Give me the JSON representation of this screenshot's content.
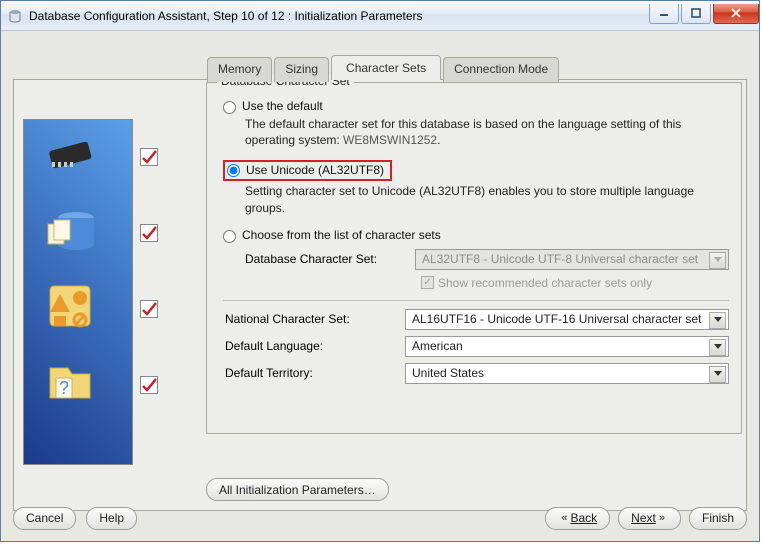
{
  "window": {
    "title": "Database Configuration Assistant, Step 10 of 12 : Initialization Parameters"
  },
  "tabs": {
    "memory": "Memory",
    "sizing": "Sizing",
    "charsets": "Character Sets",
    "connmode": "Connection Mode",
    "active": "charsets"
  },
  "group": {
    "title": "Database Character Set",
    "opt_default": {
      "label": "Use the default",
      "desc_pre": "The default character set for this database is based on the language setting of this operating system: ",
      "os_charset": "WE8MSWIN1252",
      "desc_post": "."
    },
    "opt_unicode": {
      "label": "Use Unicode (AL32UTF8)",
      "desc": "Setting character set to Unicode (AL32UTF8) enables you to store multiple language groups."
    },
    "opt_list": {
      "label": "Choose from the list of character sets",
      "field_label": "Database Character Set:",
      "value": "AL32UTF8 - Unicode UTF-8 Universal character set",
      "checkbox_label": "Show recommended character sets only",
      "checkbox_checked": true
    },
    "national": {
      "label": "National Character Set:",
      "value": "AL16UTF16 - Unicode UTF-16 Universal character set"
    },
    "lang": {
      "label": "Default Language:",
      "value": "American"
    },
    "territory": {
      "label": "Default Territory:",
      "value": "United States"
    }
  },
  "buttons": {
    "all_params": "All Initialization Parameters…",
    "cancel": "Cancel",
    "help": "Help",
    "back": "Back",
    "next": "Next",
    "finish": "Finish"
  }
}
